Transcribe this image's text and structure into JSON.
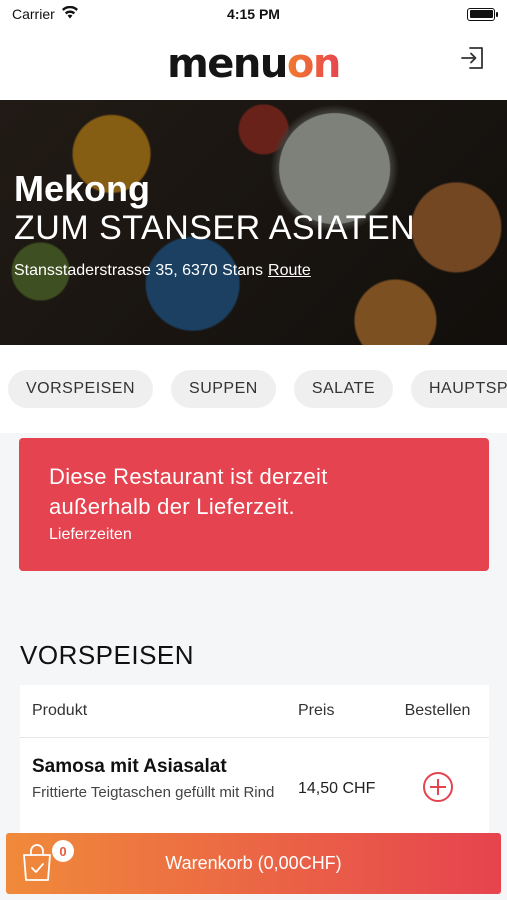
{
  "status_bar": {
    "carrier": "Carrier",
    "time": "4:15 PM"
  },
  "header": {
    "logo_left": "menu",
    "logo_right": "on"
  },
  "hero": {
    "name": "Mekong",
    "subtitle": "ZUM STANSER ASIATEN",
    "address": "Stansstaderstrasse 35, 6370 Stans",
    "route_label": "Route"
  },
  "categories": [
    "VORSPEISEN",
    "SUPPEN",
    "SALATE",
    "HAUPTSPEIS"
  ],
  "alert": {
    "line1": "Diese Restaurant ist derzeit",
    "line2": "außerhalb der Lieferzeit.",
    "link": "Lieferzeiten"
  },
  "section": {
    "title": "VORSPEISEN"
  },
  "table": {
    "headers": {
      "product": "Produkt",
      "price": "Preis",
      "order": "Bestellen"
    },
    "rows": [
      {
        "name": "Samosa mit Asiasalat",
        "description": "Frittierte Teigtaschen gefüllt mit Rind",
        "price": "14,50 CHF"
      }
    ]
  },
  "cart": {
    "label": "Warenkorb (0,00CHF)",
    "count": "0"
  },
  "colors": {
    "accent_red": "#e4434f",
    "accent_orange": "#f08a3a"
  }
}
